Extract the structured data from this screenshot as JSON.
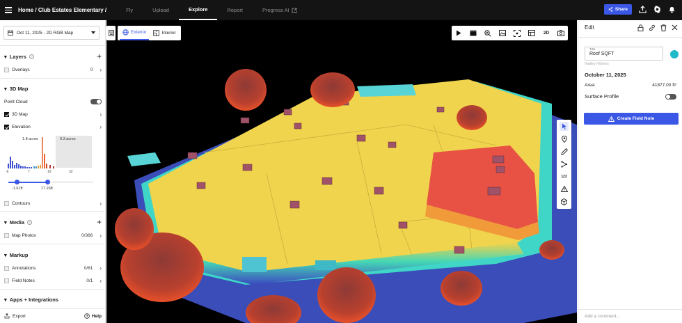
{
  "topbar": {
    "breadcrumb": "Home / Club Estates Elementary /",
    "nav": [
      {
        "label": "Fly",
        "active": false
      },
      {
        "label": "Upload",
        "active": false
      },
      {
        "label": "Explore",
        "active": true
      },
      {
        "label": "Report",
        "active": false
      },
      {
        "label": "Progress AI",
        "active": false
      }
    ],
    "share_label": "Share",
    "icons": [
      "upload-icon",
      "gear-icon",
      "bell-icon"
    ]
  },
  "sidebar": {
    "date_select": "Oct 11, 2025 - 2D RGB Map",
    "layers": {
      "title": "Layers",
      "overlays_label": "Overlays",
      "overlays_count": "0"
    },
    "map3d": {
      "title": "3D Map",
      "point_cloud_label": "Point Cloud",
      "map3d_label": "3D Map",
      "elevation_label": "Elevation",
      "hist_left_label": "1.8 acres",
      "hist_right_label": "0.3 acres",
      "ticks": [
        "-6",
        "7",
        "19",
        "32"
      ],
      "range_min": "-1.61ft",
      "range_max": "17.26ft",
      "contours_label": "Contours"
    },
    "media": {
      "title": "Media",
      "map_photos_label": "Map Photos",
      "map_photos_count": "0/366"
    },
    "markup": {
      "title": "Markup",
      "annotations_label": "Annotations",
      "annotations_count": "0/61",
      "field_notes_label": "Field Notes",
      "field_notes_count": "0/1"
    },
    "apps": {
      "title": "Apps + Integrations"
    },
    "footer": {
      "export_label": "Export",
      "help_label": "Help"
    }
  },
  "map": {
    "view_options": [
      {
        "label": "Exterior",
        "active": true
      },
      {
        "label": "Interior",
        "active": false
      }
    ],
    "toolbar_icons": [
      "play-icon",
      "clapper-icon",
      "zoom-icon",
      "image-icon",
      "focus-icon",
      "layout-icon",
      "2D",
      "camera-icon"
    ],
    "toolbar_2d_label": "2D",
    "vertical_tools": [
      "pointer-icon",
      "pin-icon",
      "pencil-icon",
      "route-icon",
      "123",
      "warning-icon",
      "cube-icon"
    ],
    "measure_label": "123"
  },
  "edit_panel": {
    "title": "Edit",
    "field_title_label": "Title",
    "field_title_value": "Roof SQFT",
    "author": "Hadley Hickens",
    "date": "October 11, 2025",
    "area_label": "Area:",
    "area_value": "41877.00 ft²",
    "surface_profile_label": "Surface Profile",
    "create_button_label": "Create Field Note",
    "comment_placeholder": "Add a comment...",
    "swatch_color": "#1fb9c9"
  },
  "colors": {
    "accent": "#3b57e6",
    "topbar": "#141414"
  }
}
